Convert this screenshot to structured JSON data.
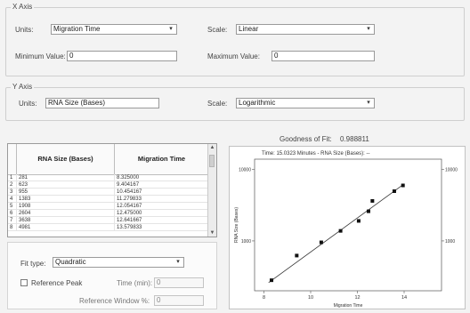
{
  "x_axis": {
    "title": "X Axis",
    "units_label": "Units:",
    "units_value": "Migration Time",
    "scale_label": "Scale:",
    "scale_value": "Linear",
    "min_label": "Minimum Value:",
    "min_value": "0",
    "max_label": "Maximum Value:",
    "max_value": "0"
  },
  "y_axis": {
    "title": "Y Axis",
    "units_label": "Units:",
    "units_value": "RNA Size (Bases)",
    "scale_label": "Scale:",
    "scale_value": "Logarithmic"
  },
  "fit": {
    "goodness_label": "Goodness of Fit:",
    "goodness_value": "0.988811"
  },
  "table": {
    "headers": [
      "RNA Size (Bases)",
      "Migration Time"
    ],
    "rows": [
      {
        "n": "1",
        "size": "281",
        "time": "8.325000"
      },
      {
        "n": "2",
        "size": "623",
        "time": "9.404167"
      },
      {
        "n": "3",
        "size": "955",
        "time": "10.454167"
      },
      {
        "n": "4",
        "size": "1383",
        "time": "11.279833"
      },
      {
        "n": "5",
        "size": "1908",
        "time": "12.054167"
      },
      {
        "n": "6",
        "size": "2604",
        "time": "12.475000"
      },
      {
        "n": "7",
        "size": "3638",
        "time": "12.641667"
      },
      {
        "n": "8",
        "size": "4981",
        "time": "13.579833"
      }
    ]
  },
  "options": {
    "fit_type_label": "Fit type:",
    "fit_type_value": "Quadratic",
    "reference_peak_label": "Reference Peak",
    "time_label": "Time (min):",
    "time_value": "0",
    "window_label": "Reference Window %:",
    "window_value": "0"
  },
  "chart_data": {
    "type": "scatter",
    "title": "Time: 15.0323 Minutes - RNA Size (Bases): --",
    "xlabel": "Migration Time",
    "ylabel": "RNA Size (Bases)",
    "x_scale": "linear",
    "y_scale": "log",
    "xlim": [
      7.6,
      15.6
    ],
    "ylim": [
      200,
      14000
    ],
    "x_ticks": [
      "8",
      "10",
      "12",
      "14"
    ],
    "y_ticks_left": [
      "1000",
      "10000"
    ],
    "y_ticks_right": [
      "1000",
      "10000"
    ],
    "points": [
      {
        "x": 8.325,
        "y": 281
      },
      {
        "x": 9.404167,
        "y": 623
      },
      {
        "x": 10.454167,
        "y": 955
      },
      {
        "x": 11.279833,
        "y": 1383
      },
      {
        "x": 12.054167,
        "y": 1908
      },
      {
        "x": 12.475,
        "y": 2604
      },
      {
        "x": 12.641667,
        "y": 3638
      },
      {
        "x": 13.579833,
        "y": 4981
      },
      {
        "x": 13.95,
        "y": 6000
      }
    ],
    "fit_line": [
      {
        "x": 8.2,
        "y": 260
      },
      {
        "x": 14.0,
        "y": 6300
      }
    ]
  }
}
